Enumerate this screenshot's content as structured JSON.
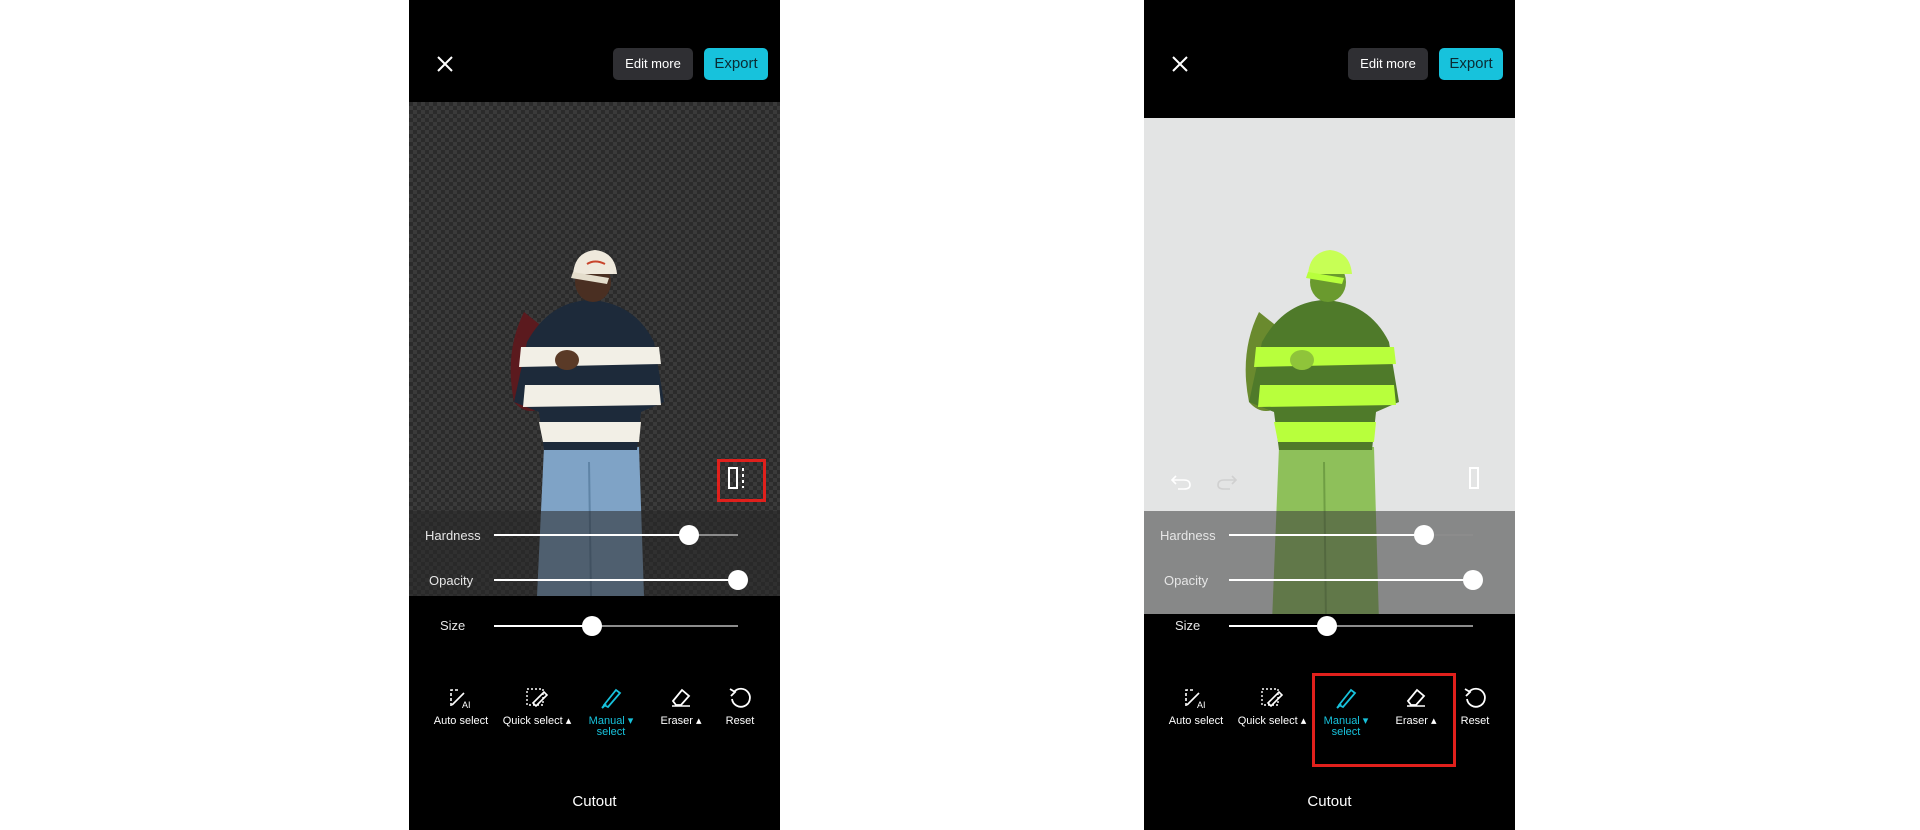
{
  "screens": [
    {
      "header": {
        "edit_more_label": "Edit more",
        "export_label": "Export"
      },
      "sliders": {
        "hardness_label": "Hardness",
        "hardness_value": 0.8,
        "opacity_label": "Opacity",
        "opacity_value": 1.0,
        "size_label": "Size",
        "size_value": 0.4
      },
      "tools": [
        {
          "label": "Auto select",
          "icon": "auto-select-icon"
        },
        {
          "label": "Quick select ▴",
          "icon": "quick-select-icon"
        },
        {
          "label": "Manual ▾\nselect",
          "icon": "manual-select-icon",
          "active": true
        },
        {
          "label": "Eraser ▴",
          "icon": "eraser-icon"
        },
        {
          "label": "Reset",
          "icon": "reset-icon"
        }
      ],
      "footer_title": "Cutout",
      "highlight": "compare-button"
    },
    {
      "header": {
        "edit_more_label": "Edit more",
        "export_label": "Export"
      },
      "sliders": {
        "hardness_label": "Hardness",
        "hardness_value": 0.8,
        "opacity_label": "Opacity",
        "opacity_value": 1.0,
        "size_label": "Size",
        "size_value": 0.4
      },
      "tools": [
        {
          "label": "Auto select",
          "icon": "auto-select-icon"
        },
        {
          "label": "Quick select ▴",
          "icon": "quick-select-icon"
        },
        {
          "label": "Manual ▾\nselect",
          "icon": "manual-select-icon",
          "active": true
        },
        {
          "label": "Eraser ▴",
          "icon": "eraser-icon"
        },
        {
          "label": "Reset",
          "icon": "reset-icon"
        }
      ],
      "footer_title": "Cutout",
      "highlight": "manual-select-and-eraser"
    }
  ],
  "colors": {
    "accent": "#17c2dc",
    "highlight_box": "#e0201c",
    "mask_overlay": "#b8ff3c"
  }
}
